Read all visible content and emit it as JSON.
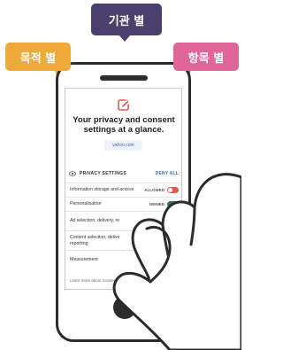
{
  "tags": {
    "organization": "기관 별",
    "purpose": "목적 별",
    "item": "항목 별"
  },
  "screen": {
    "headline": "Your privacy and consent settings at a glance.",
    "domain": "yahoo.com",
    "privacy_settings_label": "PRIVACY SETTINGS",
    "deny_all_label": "DENY ALL",
    "rows": [
      {
        "label": "Information storage and access",
        "status": "ALLOWED",
        "toggle": "on"
      },
      {
        "label": "Personalisation",
        "status": "DENIED",
        "toggle": "off"
      },
      {
        "label": "Ad selection, delivery, re",
        "status": "",
        "toggle": "on"
      },
      {
        "label": "Content selection, delive",
        "label2": "reporting",
        "status": "",
        "toggle": ""
      },
      {
        "label": "Measurement",
        "status": "",
        "toggle": ""
      }
    ],
    "learn_more": "Learn more about iconsent ›"
  },
  "colors": {
    "org_tag": "#4b3f6d",
    "purpose_tag": "#f0aa3c",
    "item_tag": "#e0669a",
    "toggle_on": "#e8584f",
    "toggle_off": "#2f6f7d",
    "link": "#3b66b5"
  },
  "icons": [
    "consent-logo-icon",
    "eye-icon",
    "hand-icon"
  ]
}
